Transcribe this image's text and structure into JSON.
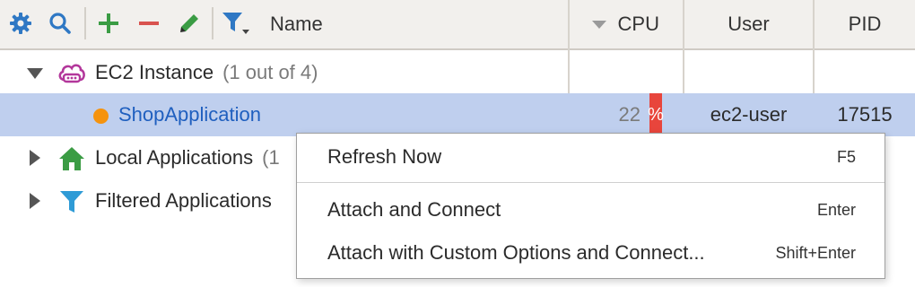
{
  "toolbar": {
    "buttons": [
      {
        "name": "settings-icon",
        "color": "#2f78c4"
      },
      {
        "name": "search-icon",
        "color": "#2f78c4"
      },
      {
        "name": "add-icon",
        "color": "#3b9c44"
      },
      {
        "name": "remove-icon",
        "color": "#d9534f"
      },
      {
        "name": "edit-icon",
        "color": "#3b9c44"
      },
      {
        "name": "filter-icon",
        "color": "#2f78c4"
      }
    ]
  },
  "columns": {
    "name": "Name",
    "cpu": "CPU",
    "user": "User",
    "pid": "PID",
    "sort_icon": "sort-descending-icon"
  },
  "tree": {
    "ec2": {
      "label": "EC2 Instance",
      "count": "(1 out of 4)",
      "icon": "cloud-icon",
      "icon_color": "#b3379b",
      "expanded": true
    },
    "app": {
      "label": "ShopApplication",
      "status_color": "#f5930e",
      "cpu_value": "22",
      "cpu_unit": "%",
      "cpu_percent": 22,
      "cpu_bar_color": "#e8453c",
      "user": "ec2-user",
      "pid": "17515"
    },
    "local": {
      "label": "Local Applications",
      "count_partial": "(1",
      "icon": "home-icon",
      "icon_color": "#3b9c44",
      "expanded": false
    },
    "filtered": {
      "label": "Filtered Applications",
      "icon": "filter-icon",
      "icon_color": "#2f9bd6",
      "expanded": false
    }
  },
  "context_menu": {
    "items": [
      {
        "label": "Refresh Now",
        "shortcut": "F5"
      },
      {
        "label": "Attach and Connect",
        "shortcut": "Enter"
      },
      {
        "label": "Attach with Custom Options and Connect...",
        "shortcut": "Shift+Enter"
      }
    ]
  },
  "colors": {
    "selection": "#bfcfee",
    "link_text": "#1f5fbf",
    "secondary_text": "#7a7a7a"
  }
}
